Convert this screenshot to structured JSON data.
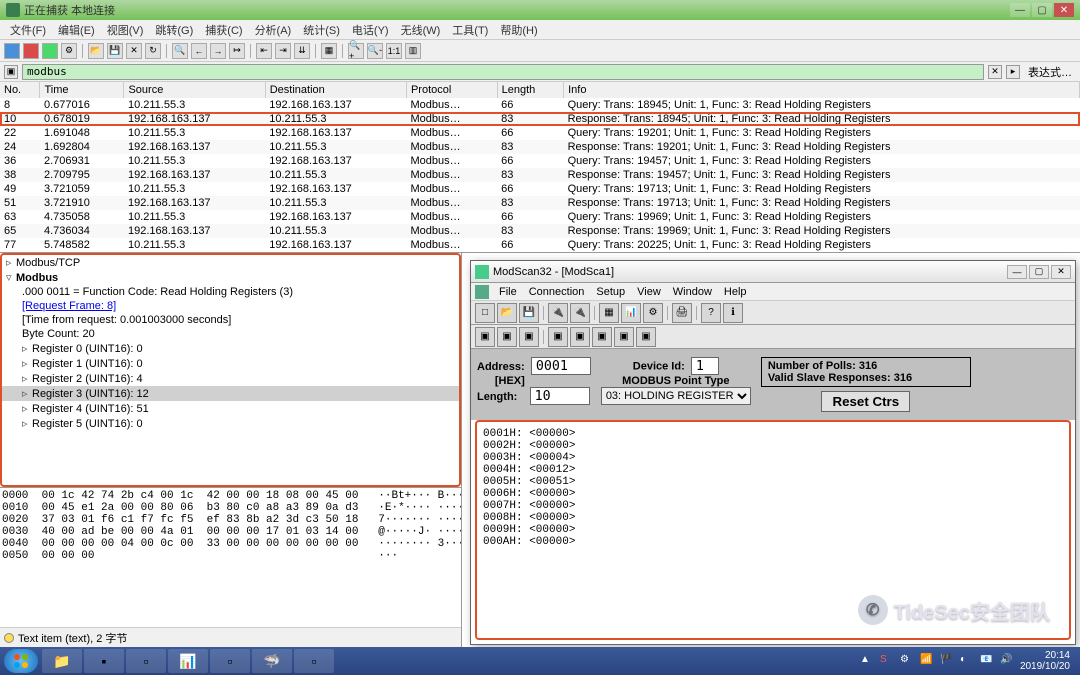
{
  "ws": {
    "title": "正在捕获 本地连接",
    "menu": [
      "文件(F)",
      "编辑(E)",
      "视图(V)",
      "跳转(G)",
      "捕获(C)",
      "分析(A)",
      "统计(S)",
      "电话(Y)",
      "无线(W)",
      "工具(T)",
      "帮助(H)"
    ],
    "filter": {
      "value": "modbus",
      "expr": "表达式…"
    },
    "headers": [
      "No.",
      "Time",
      "Source",
      "Destination",
      "Protocol",
      "Length",
      "Info"
    ],
    "packets": [
      {
        "no": "8",
        "time": "0.677016",
        "src": "10.211.55.3",
        "dst": "192.168.163.137",
        "proto": "Modbus…",
        "len": "66",
        "info": "   Query: Trans: 18945; Unit:   1, Func:   3: Read Holding Registers",
        "hl": false
      },
      {
        "no": "10",
        "time": "0.678019",
        "src": "192.168.163.137",
        "dst": "10.211.55.3",
        "proto": "Modbus…",
        "len": "83",
        "info": "Response: Trans: 18945; Unit:   1, Func:   3: Read Holding Registers",
        "hl": true
      },
      {
        "no": "22",
        "time": "1.691048",
        "src": "10.211.55.3",
        "dst": "192.168.163.137",
        "proto": "Modbus…",
        "len": "66",
        "info": "   Query: Trans: 19201; Unit:   1, Func:   3: Read Holding Registers",
        "hl": false
      },
      {
        "no": "24",
        "time": "1.692804",
        "src": "192.168.163.137",
        "dst": "10.211.55.3",
        "proto": "Modbus…",
        "len": "83",
        "info": "Response: Trans: 19201; Unit:   1, Func:   3: Read Holding Registers",
        "hl": false
      },
      {
        "no": "36",
        "time": "2.706931",
        "src": "10.211.55.3",
        "dst": "192.168.163.137",
        "proto": "Modbus…",
        "len": "66",
        "info": "   Query: Trans: 19457; Unit:   1, Func:   3: Read Holding Registers",
        "hl": false
      },
      {
        "no": "38",
        "time": "2.709795",
        "src": "192.168.163.137",
        "dst": "10.211.55.3",
        "proto": "Modbus…",
        "len": "83",
        "info": "Response: Trans: 19457; Unit:   1, Func:   3: Read Holding Registers",
        "hl": false
      },
      {
        "no": "49",
        "time": "3.721059",
        "src": "10.211.55.3",
        "dst": "192.168.163.137",
        "proto": "Modbus…",
        "len": "66",
        "info": "   Query: Trans: 19713; Unit:   1, Func:   3: Read Holding Registers",
        "hl": false
      },
      {
        "no": "51",
        "time": "3.721910",
        "src": "192.168.163.137",
        "dst": "10.211.55.3",
        "proto": "Modbus…",
        "len": "83",
        "info": "Response: Trans: 19713; Unit:   1, Func:   3: Read Holding Registers",
        "hl": false
      },
      {
        "no": "63",
        "time": "4.735058",
        "src": "10.211.55.3",
        "dst": "192.168.163.137",
        "proto": "Modbus…",
        "len": "66",
        "info": "   Query: Trans: 19969; Unit:   1, Func:   3: Read Holding Registers",
        "hl": false
      },
      {
        "no": "65",
        "time": "4.736034",
        "src": "192.168.163.137",
        "dst": "10.211.55.3",
        "proto": "Modbus…",
        "len": "83",
        "info": "Response: Trans: 19969; Unit:   1, Func:   3: Read Holding Registers",
        "hl": false
      },
      {
        "no": "77",
        "time": "5.748582",
        "src": "10.211.55.3",
        "dst": "192.168.163.137",
        "proto": "Modbus…",
        "len": "66",
        "info": "   Query: Trans: 20225; Unit:   1, Func:   3: Read Holding Registers",
        "hl": false
      }
    ],
    "tree": {
      "modbus_tcp": "Modbus/TCP",
      "modbus": "Modbus",
      "func": ".000 0011 = Function Code: Read Holding Registers (3)",
      "req_frame": "[Request Frame: 8]",
      "time_req": "[Time from request: 0.001003000 seconds]",
      "byte_count": "Byte Count: 20",
      "reg0": "Register 0 (UINT16): 0",
      "reg1": "Register 1 (UINT16): 0",
      "reg2": "Register 2 (UINT16): 4",
      "reg3": "Register 3 (UINT16): 12",
      "reg4": "Register 4 (UINT16): 51",
      "reg5": "Register 5 (UINT16): 0"
    },
    "hex": "0000  00 1c 42 74 2b c4 00 1c  42 00 00 18 08 00 45 00   ··Bt+··· B·····E·\n0010  00 45 e1 2a 00 00 80 06  b3 80 c0 a8 a3 89 0a d3   ·E·*···· ········\n0020  37 03 01 f6 c1 f7 fc f5  ef 83 8b a2 3d c3 50 18   7······· ····=·P·\n0030  40 00 ad be 00 00 4a 01  00 00 00 17 01 03 14 00   @·····J· ········\n0040  00 00 00 00 04 00 0c 00  33 00 00 00 00 00 00 00   ········ 3·······\n0050  00 00 00                                           ···",
    "status": "Text item (text), 2 字节"
  },
  "ms": {
    "title": "ModScan32 - [ModSca1]",
    "menu": [
      "File",
      "Connection",
      "Setup",
      "View",
      "Window",
      "Help"
    ],
    "addr_label": "Address:",
    "hex_label": "[HEX]",
    "len_label": "Length:",
    "addr_val": "0001",
    "len_val": "10",
    "devid_label": "Device Id:",
    "devid_val": "1",
    "point_label": "MODBUS Point Type",
    "point_val": "03: HOLDING REGISTER",
    "polls": "Number of Polls: 316",
    "valid": "Valid Slave Responses: 316",
    "reset": "Reset Ctrs",
    "data": "0001H: <00000>\n0002H: <00000>\n0003H: <00004>\n0004H: <00012>\n0005H: <00051>\n0006H: <00000>\n0007H: <00000>\n0008H: <00000>\n0009H: <00000>\n000AH: <00000>"
  },
  "watermark": "TideSec安全团队",
  "clock": {
    "time": "20:14",
    "date": "2019/10/20"
  }
}
